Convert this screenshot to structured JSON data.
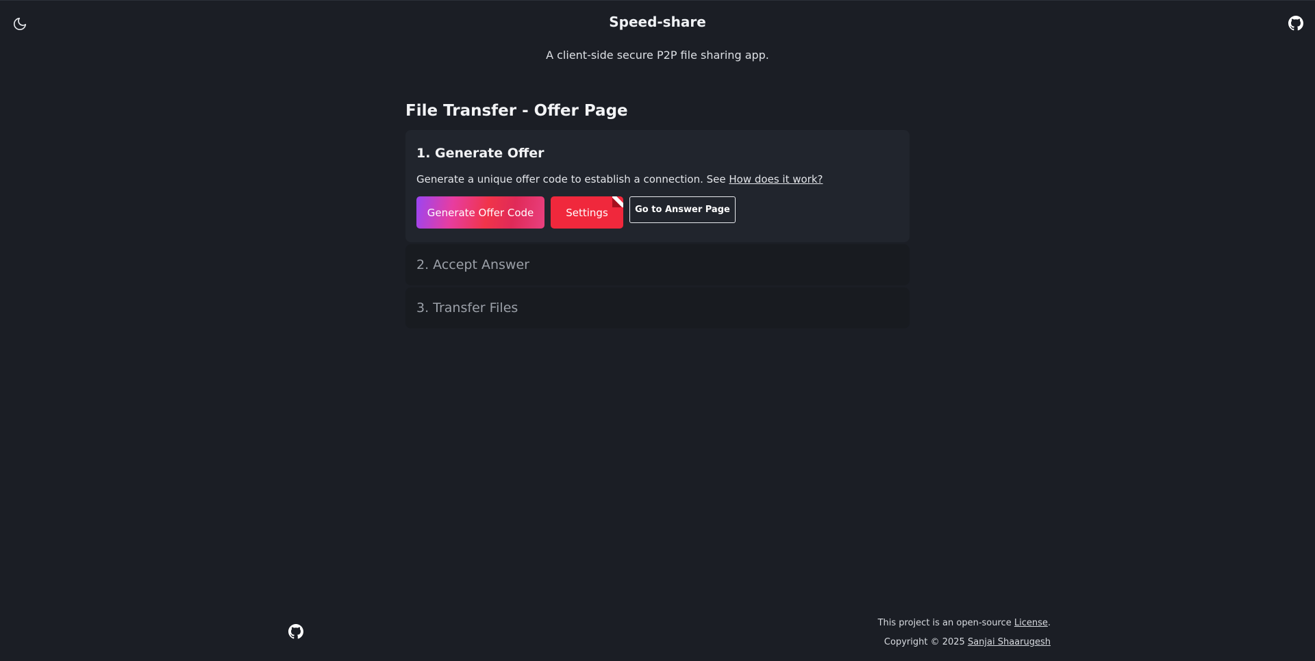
{
  "header": {
    "title": "Speed-share",
    "tagline": "A client-side secure P2P file sharing app.",
    "theme_icon": "moon-icon",
    "github_icon": "github-icon"
  },
  "main": {
    "heading": "File Transfer - Offer Page",
    "steps": [
      {
        "title": "1. Generate Offer",
        "description": "Generate a unique offer code to establish a connection. See",
        "link_label": "How does it work?",
        "buttons": {
          "generate": "Generate Offer Code",
          "settings": "Settings",
          "answer_page": "Go to Answer Page"
        }
      },
      {
        "title": "2. Accept Answer"
      },
      {
        "title": "3. Transfer Files"
      }
    ]
  },
  "footer": {
    "license_prefix": "This project is an open-source",
    "license_link": "License",
    "license_suffix": ".",
    "copyright_prefix": "Copyright © 2025",
    "author_link": "Sanjai Shaarugesh",
    "github_icon": "github-icon"
  },
  "colors": {
    "background": "#1b1e25",
    "settings_button": "#f0283c",
    "gradient_start": "#9b45f2",
    "gradient_end": "#f0344a"
  }
}
